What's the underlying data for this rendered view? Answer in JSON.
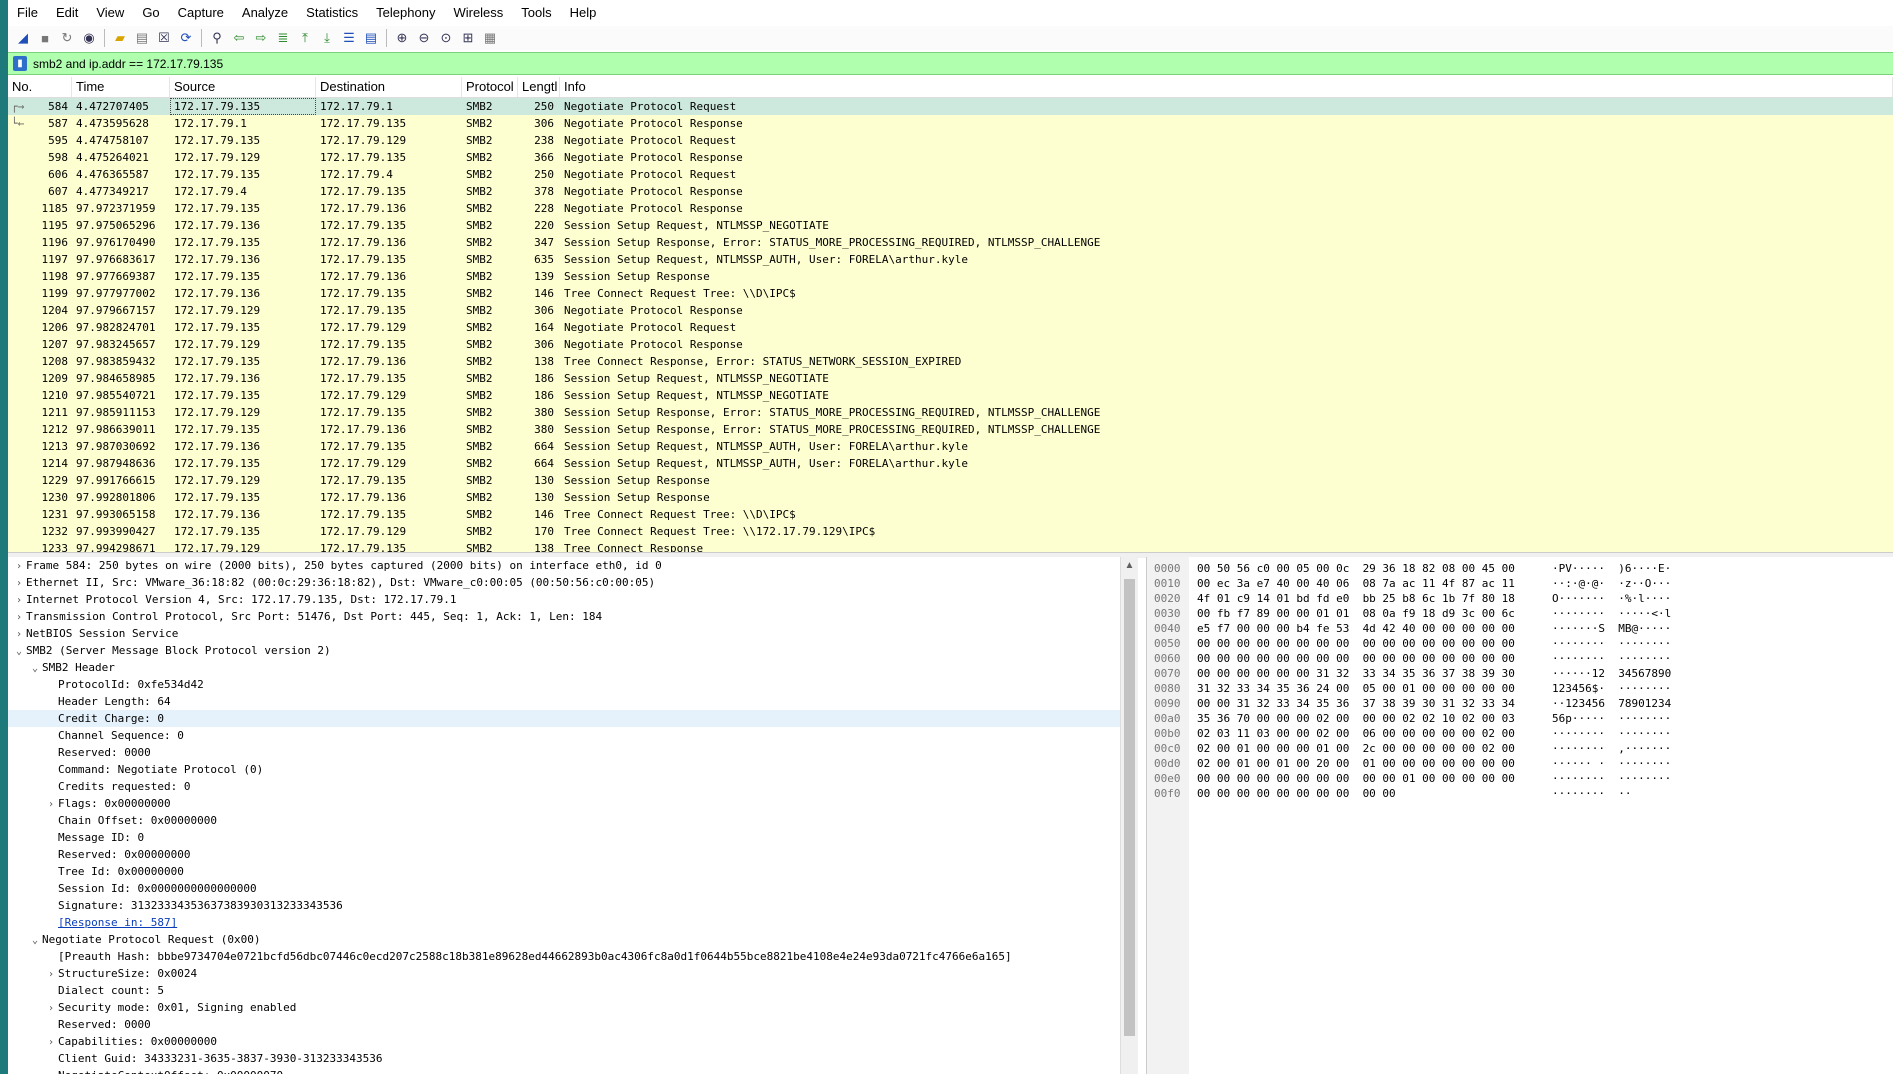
{
  "menu": [
    "File",
    "Edit",
    "View",
    "Go",
    "Capture",
    "Analyze",
    "Statistics",
    "Telephony",
    "Wireless",
    "Tools",
    "Help"
  ],
  "toolbar_icons": [
    "shark-fin-start-icon",
    "stop-icon",
    "restart-icon",
    "options-gear-icon",
    "open-folder-icon",
    "save-icon",
    "close-file-icon",
    "reload-icon",
    "find-icon",
    "go-back-icon",
    "go-forward-icon",
    "go-to-packet-icon",
    "first-packet-icon",
    "last-packet-icon",
    "autoscroll-icon",
    "colorize-icon",
    "zoom-in-icon",
    "zoom-out-icon",
    "normal-size-icon",
    "resize-columns-icon",
    "layout-icon"
  ],
  "filter": {
    "text": "smb2 and ip.addr == 172.17.79.135"
  },
  "columns": {
    "no": "No.",
    "time": "Time",
    "src": "Source",
    "dst": "Destination",
    "proto": "Protocol",
    "len": "Lengtl",
    "info": "Info"
  },
  "packets": [
    {
      "no": "584",
      "time": "4.472707405",
      "src": "172.17.79.135",
      "dst": "172.17.79.1",
      "proto": "SMB2",
      "len": "250",
      "info": "Negotiate Protocol Request"
    },
    {
      "no": "587",
      "time": "4.473595628",
      "src": "172.17.79.1",
      "dst": "172.17.79.135",
      "proto": "SMB2",
      "len": "306",
      "info": "Negotiate Protocol Response"
    },
    {
      "no": "595",
      "time": "4.474758107",
      "src": "172.17.79.135",
      "dst": "172.17.79.129",
      "proto": "SMB2",
      "len": "238",
      "info": "Negotiate Protocol Request"
    },
    {
      "no": "598",
      "time": "4.475264021",
      "src": "172.17.79.129",
      "dst": "172.17.79.135",
      "proto": "SMB2",
      "len": "366",
      "info": "Negotiate Protocol Response"
    },
    {
      "no": "606",
      "time": "4.476365587",
      "src": "172.17.79.135",
      "dst": "172.17.79.4",
      "proto": "SMB2",
      "len": "250",
      "info": "Negotiate Protocol Request"
    },
    {
      "no": "607",
      "time": "4.477349217",
      "src": "172.17.79.4",
      "dst": "172.17.79.135",
      "proto": "SMB2",
      "len": "378",
      "info": "Negotiate Protocol Response"
    },
    {
      "no": "1185",
      "time": "97.972371959",
      "src": "172.17.79.135",
      "dst": "172.17.79.136",
      "proto": "SMB2",
      "len": "228",
      "info": "Negotiate Protocol Response"
    },
    {
      "no": "1195",
      "time": "97.975065296",
      "src": "172.17.79.136",
      "dst": "172.17.79.135",
      "proto": "SMB2",
      "len": "220",
      "info": "Session Setup Request, NTLMSSP_NEGOTIATE"
    },
    {
      "no": "1196",
      "time": "97.976170490",
      "src": "172.17.79.135",
      "dst": "172.17.79.136",
      "proto": "SMB2",
      "len": "347",
      "info": "Session Setup Response, Error: STATUS_MORE_PROCESSING_REQUIRED, NTLMSSP_CHALLENGE"
    },
    {
      "no": "1197",
      "time": "97.976683617",
      "src": "172.17.79.136",
      "dst": "172.17.79.135",
      "proto": "SMB2",
      "len": "635",
      "info": "Session Setup Request, NTLMSSP_AUTH, User: FORELA\\arthur.kyle"
    },
    {
      "no": "1198",
      "time": "97.977669387",
      "src": "172.17.79.135",
      "dst": "172.17.79.136",
      "proto": "SMB2",
      "len": "139",
      "info": "Session Setup Response"
    },
    {
      "no": "1199",
      "time": "97.977977002",
      "src": "172.17.79.136",
      "dst": "172.17.79.135",
      "proto": "SMB2",
      "len": "146",
      "info": "Tree Connect Request Tree: \\\\D\\IPC$"
    },
    {
      "no": "1204",
      "time": "97.979667157",
      "src": "172.17.79.129",
      "dst": "172.17.79.135",
      "proto": "SMB2",
      "len": "306",
      "info": "Negotiate Protocol Response"
    },
    {
      "no": "1206",
      "time": "97.982824701",
      "src": "172.17.79.135",
      "dst": "172.17.79.129",
      "proto": "SMB2",
      "len": "164",
      "info": "Negotiate Protocol Request"
    },
    {
      "no": "1207",
      "time": "97.983245657",
      "src": "172.17.79.129",
      "dst": "172.17.79.135",
      "proto": "SMB2",
      "len": "306",
      "info": "Negotiate Protocol Response"
    },
    {
      "no": "1208",
      "time": "97.983859432",
      "src": "172.17.79.135",
      "dst": "172.17.79.136",
      "proto": "SMB2",
      "len": "138",
      "info": "Tree Connect Response, Error: STATUS_NETWORK_SESSION_EXPIRED"
    },
    {
      "no": "1209",
      "time": "97.984658985",
      "src": "172.17.79.136",
      "dst": "172.17.79.135",
      "proto": "SMB2",
      "len": "186",
      "info": "Session Setup Request, NTLMSSP_NEGOTIATE"
    },
    {
      "no": "1210",
      "time": "97.985540721",
      "src": "172.17.79.135",
      "dst": "172.17.79.129",
      "proto": "SMB2",
      "len": "186",
      "info": "Session Setup Request, NTLMSSP_NEGOTIATE"
    },
    {
      "no": "1211",
      "time": "97.985911153",
      "src": "172.17.79.129",
      "dst": "172.17.79.135",
      "proto": "SMB2",
      "len": "380",
      "info": "Session Setup Response, Error: STATUS_MORE_PROCESSING_REQUIRED, NTLMSSP_CHALLENGE"
    },
    {
      "no": "1212",
      "time": "97.986639011",
      "src": "172.17.79.135",
      "dst": "172.17.79.136",
      "proto": "SMB2",
      "len": "380",
      "info": "Session Setup Response, Error: STATUS_MORE_PROCESSING_REQUIRED, NTLMSSP_CHALLENGE"
    },
    {
      "no": "1213",
      "time": "97.987030692",
      "src": "172.17.79.136",
      "dst": "172.17.79.135",
      "proto": "SMB2",
      "len": "664",
      "info": "Session Setup Request, NTLMSSP_AUTH, User: FORELA\\arthur.kyle"
    },
    {
      "no": "1214",
      "time": "97.987948636",
      "src": "172.17.79.135",
      "dst": "172.17.79.129",
      "proto": "SMB2",
      "len": "664",
      "info": "Session Setup Request, NTLMSSP_AUTH, User: FORELA\\arthur.kyle"
    },
    {
      "no": "1229",
      "time": "97.991766615",
      "src": "172.17.79.129",
      "dst": "172.17.79.135",
      "proto": "SMB2",
      "len": "130",
      "info": "Session Setup Response"
    },
    {
      "no": "1230",
      "time": "97.992801806",
      "src": "172.17.79.135",
      "dst": "172.17.79.136",
      "proto": "SMB2",
      "len": "130",
      "info": "Session Setup Response"
    },
    {
      "no": "1231",
      "time": "97.993065158",
      "src": "172.17.79.136",
      "dst": "172.17.79.135",
      "proto": "SMB2",
      "len": "146",
      "info": "Tree Connect Request Tree: \\\\D\\IPC$"
    },
    {
      "no": "1232",
      "time": "97.993990427",
      "src": "172.17.79.135",
      "dst": "172.17.79.129",
      "proto": "SMB2",
      "len": "170",
      "info": "Tree Connect Request Tree: \\\\172.17.79.129\\IPC$"
    },
    {
      "no": "1233",
      "time": "97.994298671",
      "src": "172.17.79.129",
      "dst": "172.17.79.135",
      "proto": "SMB2",
      "len": "138",
      "info": "Tree Connect Response"
    }
  ],
  "details": [
    {
      "indent": 0,
      "arrow": "right",
      "text": "Frame 584: 250 bytes on wire (2000 bits), 250 bytes captured (2000 bits) on interface eth0, id 0"
    },
    {
      "indent": 0,
      "arrow": "right",
      "text": "Ethernet II, Src: VMware_36:18:82 (00:0c:29:36:18:82), Dst: VMware_c0:00:05 (00:50:56:c0:00:05)"
    },
    {
      "indent": 0,
      "arrow": "right",
      "text": "Internet Protocol Version 4, Src: 172.17.79.135, Dst: 172.17.79.1"
    },
    {
      "indent": 0,
      "arrow": "right",
      "text": "Transmission Control Protocol, Src Port: 51476, Dst Port: 445, Seq: 1, Ack: 1, Len: 184"
    },
    {
      "indent": 0,
      "arrow": "right",
      "text": "NetBIOS Session Service"
    },
    {
      "indent": 0,
      "arrow": "down",
      "text": "SMB2 (Server Message Block Protocol version 2)"
    },
    {
      "indent": 1,
      "arrow": "down",
      "text": "SMB2 Header"
    },
    {
      "indent": 2,
      "arrow": "",
      "text": "ProtocolId: 0xfe534d42"
    },
    {
      "indent": 2,
      "arrow": "",
      "text": "Header Length: 64"
    },
    {
      "indent": 2,
      "arrow": "",
      "text": "Credit Charge: 0",
      "sel": true
    },
    {
      "indent": 2,
      "arrow": "",
      "text": "Channel Sequence: 0"
    },
    {
      "indent": 2,
      "arrow": "",
      "text": "Reserved: 0000"
    },
    {
      "indent": 2,
      "arrow": "",
      "text": "Command: Negotiate Protocol (0)"
    },
    {
      "indent": 2,
      "arrow": "",
      "text": "Credits requested: 0"
    },
    {
      "indent": 2,
      "arrow": "right",
      "text": "Flags: 0x00000000"
    },
    {
      "indent": 2,
      "arrow": "",
      "text": "Chain Offset: 0x00000000"
    },
    {
      "indent": 2,
      "arrow": "",
      "text": "Message ID: 0"
    },
    {
      "indent": 2,
      "arrow": "",
      "text": "Reserved: 0x00000000"
    },
    {
      "indent": 2,
      "arrow": "",
      "text": "Tree Id: 0x00000000"
    },
    {
      "indent": 2,
      "arrow": "",
      "text": "Session Id: 0x0000000000000000"
    },
    {
      "indent": 2,
      "arrow": "",
      "text": "Signature: 31323334353637383930313233343536"
    },
    {
      "indent": 2,
      "arrow": "",
      "text": "[Response in: 587]",
      "link": true
    },
    {
      "indent": 1,
      "arrow": "down",
      "text": "Negotiate Protocol Request (0x00)"
    },
    {
      "indent": 2,
      "arrow": "",
      "text": "[Preauth Hash: bbbe9734704e0721bcfd56dbc07446c0ecd207c2588c18b381e89628ed44662893b0ac4306fc8a0d1f0644b55bce8821be4108e4e24e93da0721fc4766e6a165]"
    },
    {
      "indent": 2,
      "arrow": "right",
      "text": "StructureSize: 0x0024"
    },
    {
      "indent": 2,
      "arrow": "",
      "text": "Dialect count: 5"
    },
    {
      "indent": 2,
      "arrow": "right",
      "text": "Security mode: 0x01, Signing enabled"
    },
    {
      "indent": 2,
      "arrow": "",
      "text": "Reserved: 0000"
    },
    {
      "indent": 2,
      "arrow": "right",
      "text": "Capabilities: 0x00000000"
    },
    {
      "indent": 2,
      "arrow": "",
      "text": "Client Guid: 34333231-3635-3837-3930-313233343536"
    },
    {
      "indent": 2,
      "arrow": "",
      "text": "NegotiateContextOffset: 0x00000070"
    }
  ],
  "bytes": [
    {
      "off": "0000",
      "hex": "00 50 56 c0 00 05 00 0c  29 36 18 82 08 00 45 00",
      "ascii": "·PV·····  )6····E·"
    },
    {
      "off": "0010",
      "hex": "00 ec 3a e7 40 00 40 06  08 7a ac 11 4f 87 ac 11",
      "ascii": "··:·@·@·  ·z··O···"
    },
    {
      "off": "0020",
      "hex": "4f 01 c9 14 01 bd fd e0  bb 25 b8 6c 1b 7f 80 18",
      "ascii": "O·······  ·%·l····"
    },
    {
      "off": "0030",
      "hex": "00 fb f7 89 00 00 01 01  08 0a f9 18 d9 3c 00 6c",
      "ascii": "········  ·····<·l"
    },
    {
      "off": "0040",
      "hex": "e5 f7 00 00 00 b4 fe 53  4d 42 40 00 00 00 00 00",
      "ascii": "·······S  MB@·····"
    },
    {
      "off": "0050",
      "hex": "00 00 00 00 00 00 00 00  00 00 00 00 00 00 00 00",
      "ascii": "········  ········"
    },
    {
      "off": "0060",
      "hex": "00 00 00 00 00 00 00 00  00 00 00 00 00 00 00 00",
      "ascii": "········  ········"
    },
    {
      "off": "0070",
      "hex": "00 00 00 00 00 00 31 32  33 34 35 36 37 38 39 30",
      "ascii": "······12  34567890"
    },
    {
      "off": "0080",
      "hex": "31 32 33 34 35 36 24 00  05 00 01 00 00 00 00 00",
      "ascii": "123456$·  ········"
    },
    {
      "off": "0090",
      "hex": "00 00 31 32 33 34 35 36  37 38 39 30 31 32 33 34",
      "ascii": "··123456  78901234"
    },
    {
      "off": "00a0",
      "hex": "35 36 70 00 00 00 02 00  00 00 02 02 10 02 00 03",
      "ascii": "56p·····  ········"
    },
    {
      "off": "00b0",
      "hex": "02 03 11 03 00 00 02 00  06 00 00 00 00 00 02 00",
      "ascii": "········  ········"
    },
    {
      "off": "00c0",
      "hex": "02 00 01 00 00 00 01 00  2c 00 00 00 00 00 02 00",
      "ascii": "········  ,·······"
    },
    {
      "off": "00d0",
      "hex": "02 00 01 00 01 00 20 00  01 00 00 00 00 00 00 00",
      "ascii": "······ ·  ········"
    },
    {
      "off": "00e0",
      "hex": "00 00 00 00 00 00 00 00  00 00 01 00 00 00 00 00",
      "ascii": "········  ········"
    },
    {
      "off": "00f0",
      "hex": "00 00 00 00 00 00 00 00  00 00",
      "ascii": "········  ··"
    }
  ]
}
